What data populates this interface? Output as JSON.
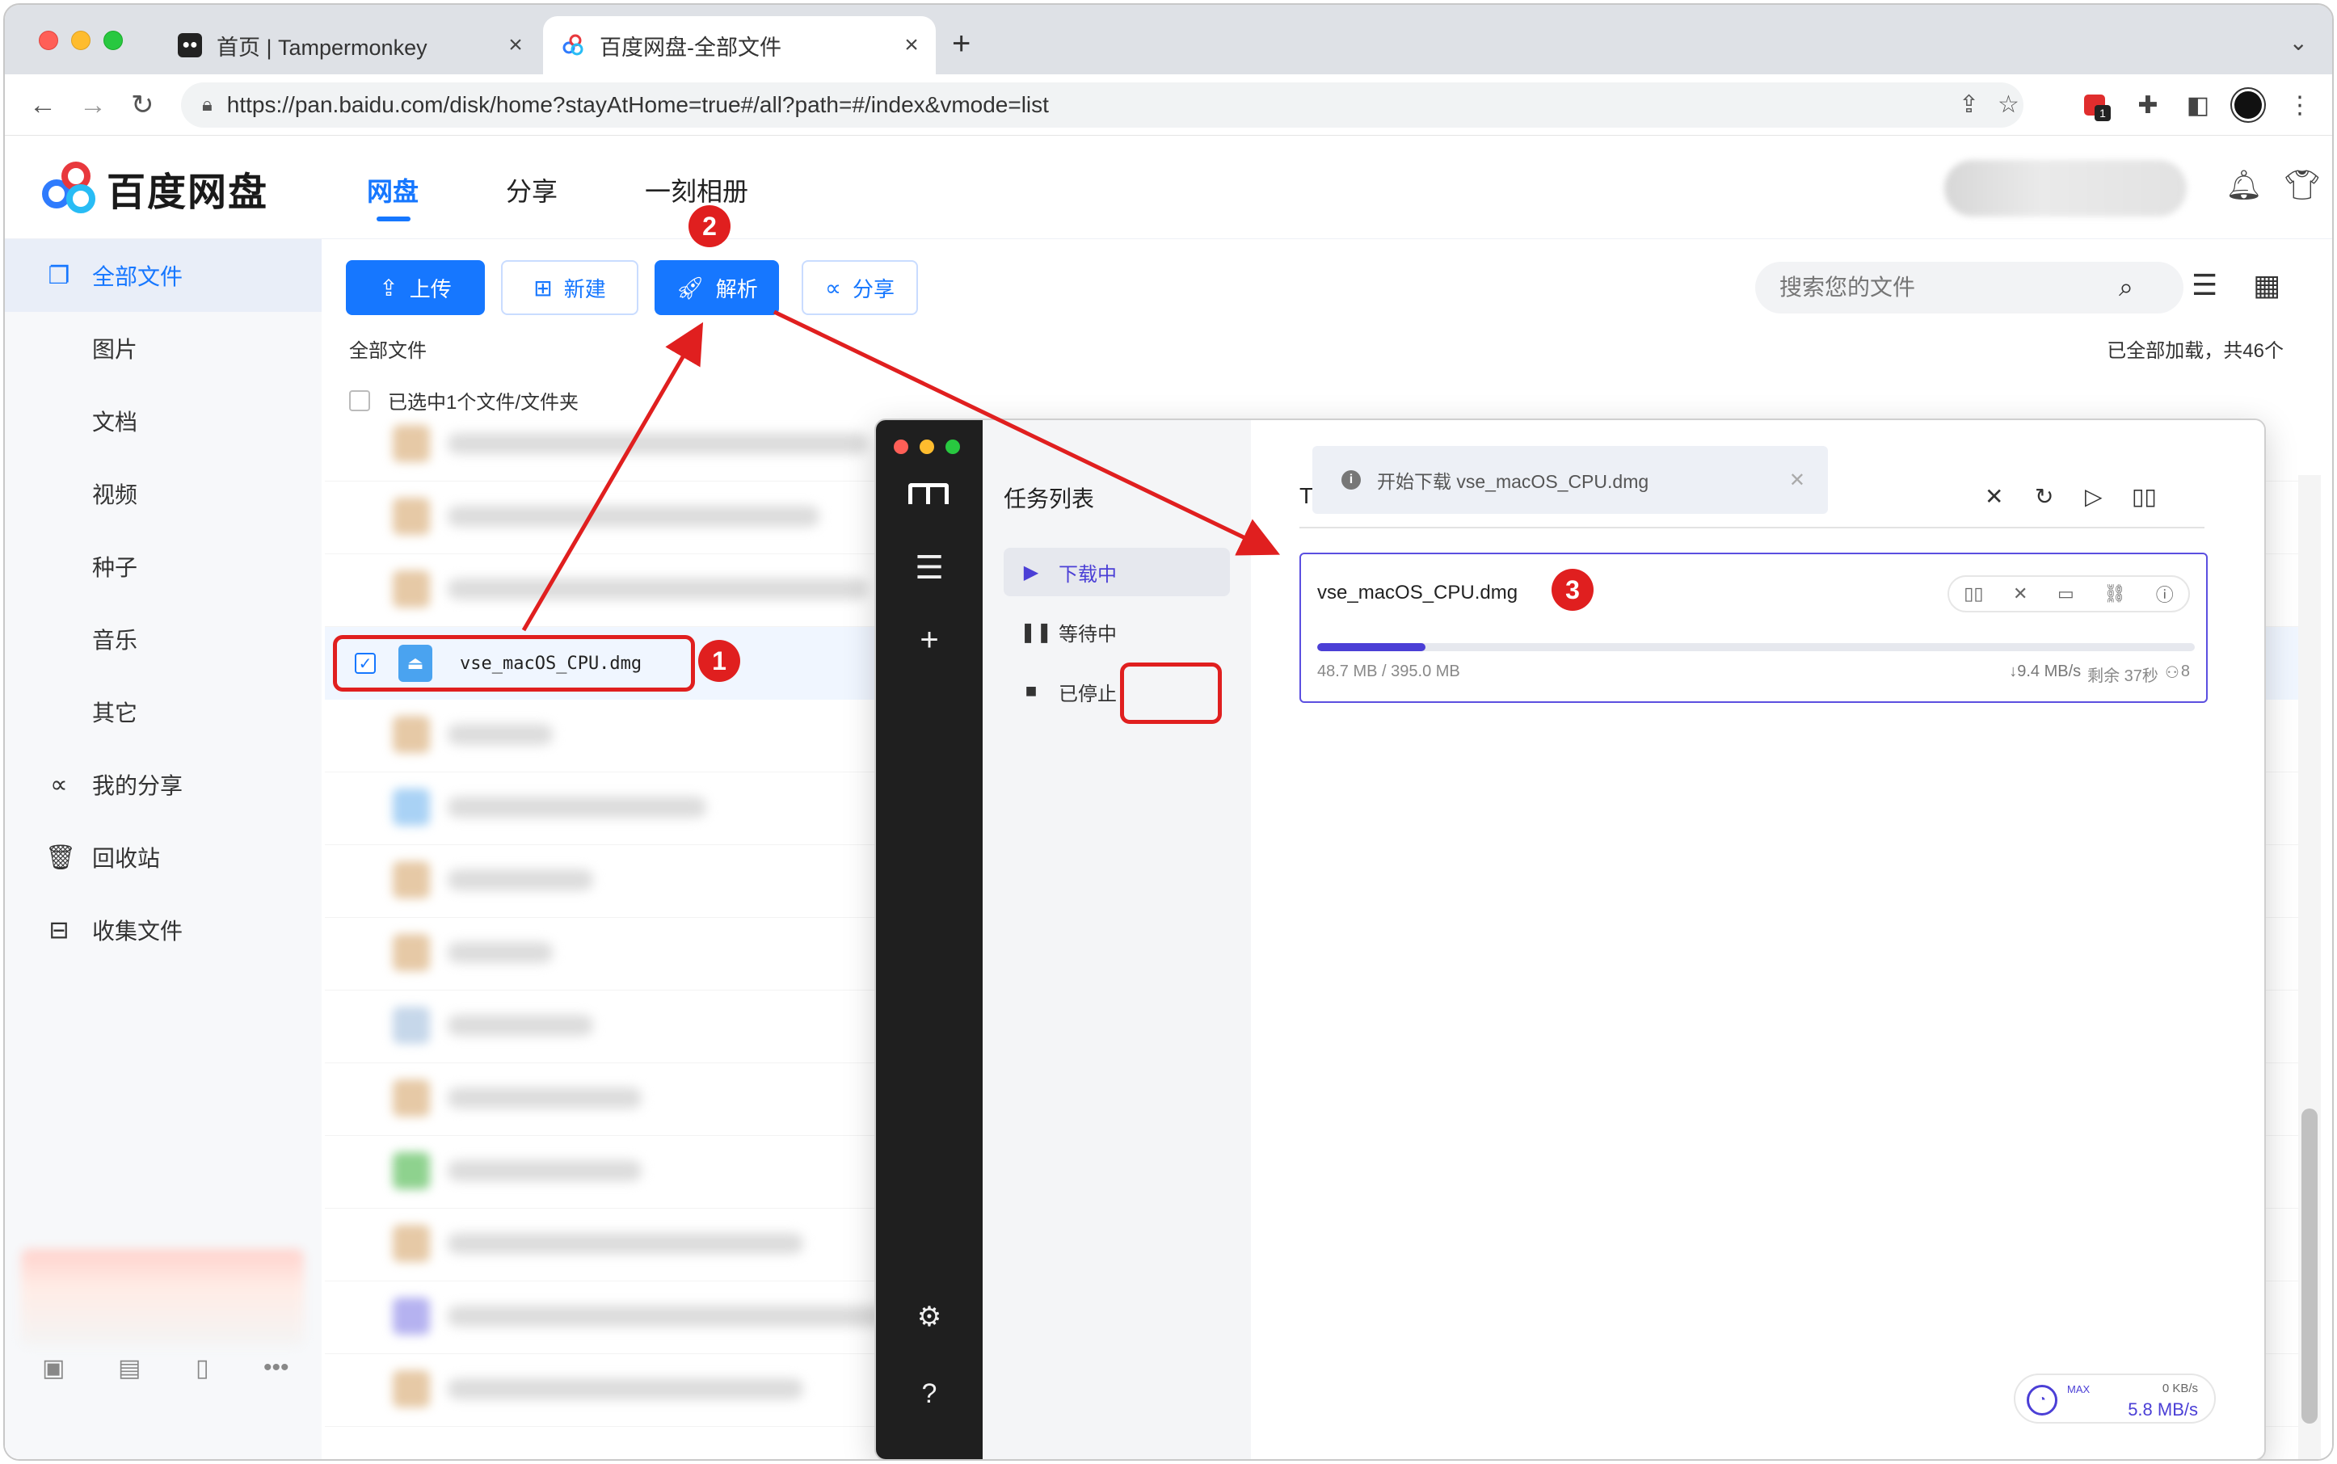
{
  "browser": {
    "tabs": [
      {
        "title": "首页 | Tampermonkey",
        "active": false
      },
      {
        "title": "百度网盘-全部文件",
        "active": true
      }
    ],
    "new_tab_icon": "plus-icon",
    "url": "https://pan.baidu.com/disk/home?stayAtHome=true#/all?path=#/index&vmode=list",
    "extension_badge": "1"
  },
  "app": {
    "logo_text": "百度网盘",
    "nav": [
      "网盘",
      "分享",
      "一刻相册"
    ],
    "active_nav": "网盘"
  },
  "sidebar": {
    "items": [
      {
        "label": "全部文件",
        "icon": "files-icon",
        "active": true
      },
      {
        "label": "图片"
      },
      {
        "label": "文档"
      },
      {
        "label": "视频"
      },
      {
        "label": "种子"
      },
      {
        "label": "音乐"
      },
      {
        "label": "其它"
      },
      {
        "label": "我的分享",
        "icon": "share-icon"
      },
      {
        "label": "回收站",
        "icon": "trash-icon"
      },
      {
        "label": "收集文件",
        "icon": "inbox-icon"
      }
    ]
  },
  "toolbar": {
    "upload": "上传",
    "new": "新建",
    "parse": "解析",
    "share": "分享",
    "search_placeholder": "搜索您的文件"
  },
  "files": {
    "breadcrumb": "全部文件",
    "loaded_status": "已全部加载，共46个",
    "selection_status": "已选中1个文件/文件夹",
    "selected_file": "vse_macOS_CPU.dmg"
  },
  "steps": [
    "1",
    "2",
    "3"
  ],
  "motrix": {
    "list_title": "任务列表",
    "filters": [
      {
        "label": "下载中",
        "icon": "play-icon",
        "active": true
      },
      {
        "label": "等待中",
        "icon": "pause-icon"
      },
      {
        "label": "已停止",
        "icon": "stop-icon"
      }
    ],
    "panel_title_fragment": "T",
    "toast": "开始下载 vse_macOS_CPU.dmg",
    "task": {
      "name": "vse_macOS_CPU.dmg",
      "progress_fraction": 0.123,
      "size": "48.7 MB / 395.0 MB",
      "speed": "↓9.4 MB/s",
      "remaining": "剩余 37秒",
      "connections": "8"
    },
    "speedometer": {
      "label": "MAX",
      "upload": "0 KB/s",
      "download": "5.8 MB/s"
    }
  },
  "colors": {
    "brand_blue": "#1677ff",
    "motrix_accent": "#4b3fd6",
    "annotation_red": "#e01f1f"
  }
}
